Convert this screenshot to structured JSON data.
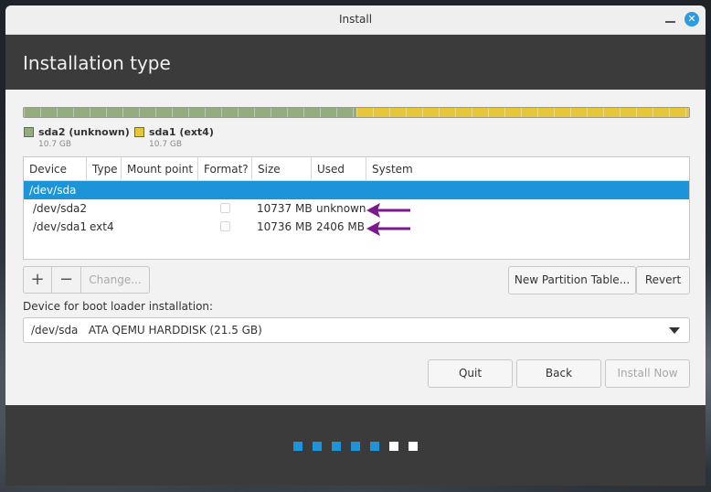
{
  "window": {
    "title": "Install"
  },
  "header": {
    "title": "Installation type"
  },
  "disk_bar": {
    "segments": [
      {
        "name": "sda2 (unknown)",
        "size": "10.7 GB",
        "color": "#93ad7f",
        "fraction": 0.5
      },
      {
        "name": "sda1 (ext4)",
        "size": "10.7 GB",
        "color": "#e6c73a",
        "fraction": 0.5
      }
    ]
  },
  "table": {
    "columns": [
      "Device",
      "Type",
      "Mount point",
      "Format?",
      "Size",
      "Used",
      "System"
    ],
    "rows": [
      {
        "device": "/dev/sda",
        "type": "",
        "mount": "",
        "size": "",
        "used": "",
        "system": "",
        "selected": true
      },
      {
        "device": "/dev/sda2",
        "type": "",
        "mount": "",
        "size": "10737 MB",
        "used": "unknown",
        "system": "",
        "selected": false
      },
      {
        "device": "/dev/sda1",
        "type": "ext4",
        "mount": "",
        "size": "10736 MB",
        "used": "2406 MB",
        "system": "",
        "selected": false
      }
    ]
  },
  "toolbar": {
    "add_label": "+",
    "remove_label": "−",
    "change_label": "Change..."
  },
  "buttons": {
    "new_partition_table": "New Partition Table...",
    "revert": "Revert",
    "quit": "Quit",
    "back": "Back",
    "install_now": "Install Now"
  },
  "bootloader": {
    "label": "Device for boot loader installation:",
    "selected": "/dev/sda   ATA QEMU HARDDISK (21.5 GB)"
  },
  "progress": {
    "total_steps": 7,
    "completed_steps": 5,
    "active_color": "#1e94d8",
    "inactive_color": "#ffffff"
  },
  "annotation": {
    "arrow_color": "#7b1a8c"
  },
  "colors": {
    "accent": "#1e94d8",
    "close_button": "#2d9be0"
  }
}
